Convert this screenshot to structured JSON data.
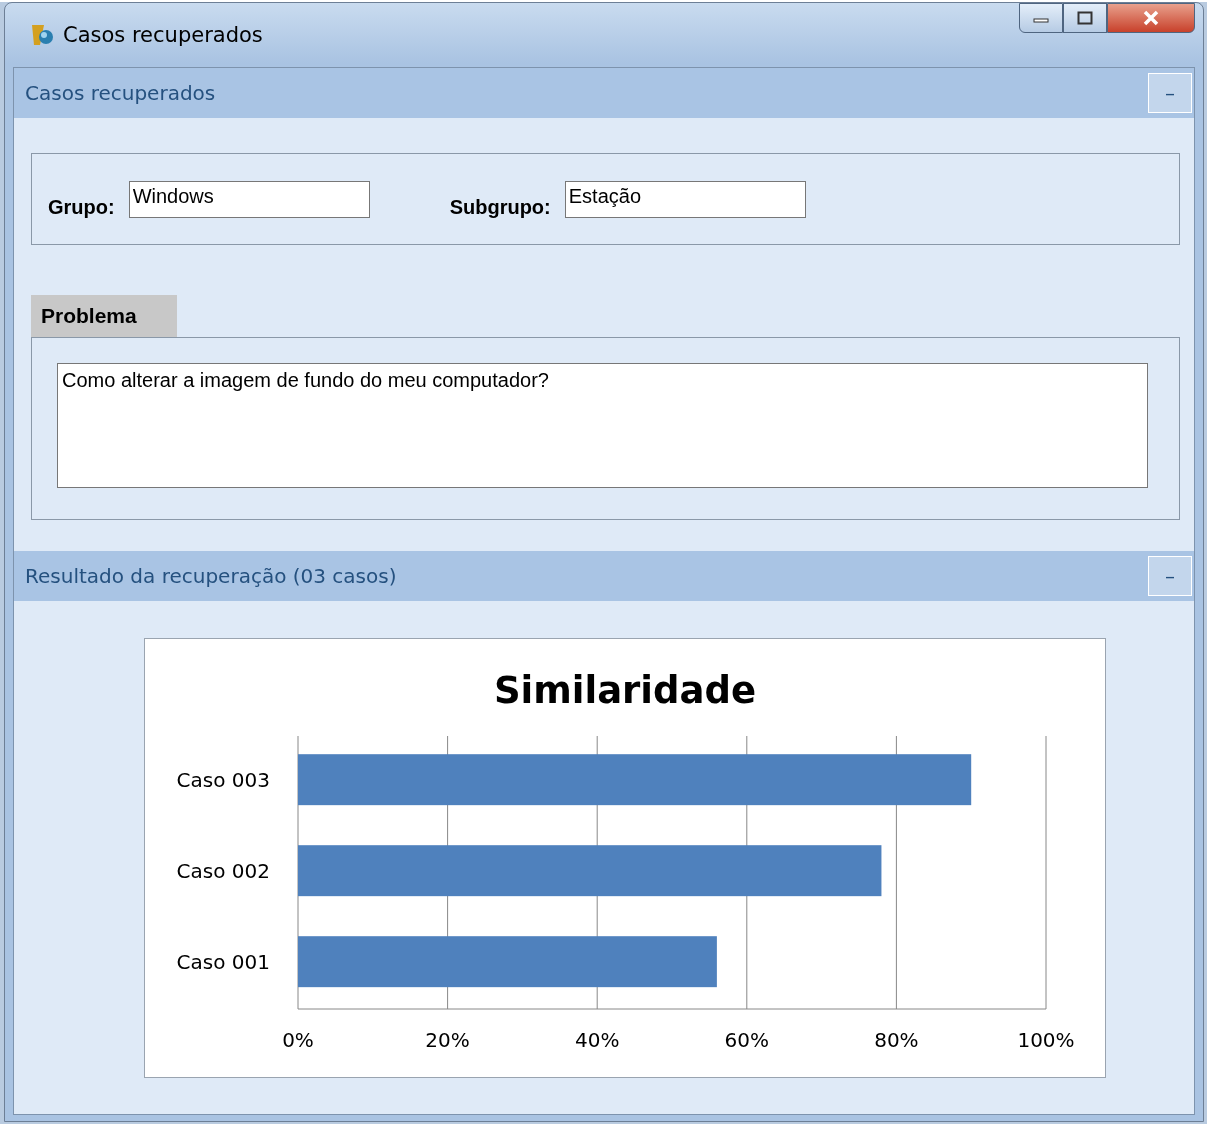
{
  "window": {
    "title": "Casos recuperados"
  },
  "sections": [
    {
      "title": "Casos recuperados",
      "toggle": "–"
    },
    {
      "title": "Resultado da recuperação (03 casos)",
      "toggle": "–"
    }
  ],
  "fields": [
    {
      "label": "Grupo:",
      "value": "Windows"
    },
    {
      "label": "Subgrupo:",
      "value": "Estação"
    }
  ],
  "problem": {
    "tab": "Problema",
    "text": "Como alterar a imagem de fundo do meu computador?"
  },
  "chart_data": {
    "type": "bar",
    "orientation": "horizontal",
    "title": "Similaridade",
    "categories": [
      "Caso 003",
      "Caso 002",
      "Caso 001"
    ],
    "values": [
      0.9,
      0.78,
      0.56
    ],
    "grid": true,
    "xlim": [
      0,
      1
    ],
    "xticks": [
      {
        "value": 0,
        "label": "0%"
      },
      {
        "value": 0.2,
        "label": "20%"
      },
      {
        "value": 0.4,
        "label": "40%"
      },
      {
        "value": 0.6,
        "label": "60%"
      },
      {
        "value": 0.8,
        "label": "80%"
      },
      {
        "value": 1,
        "label": "100%"
      }
    ]
  }
}
